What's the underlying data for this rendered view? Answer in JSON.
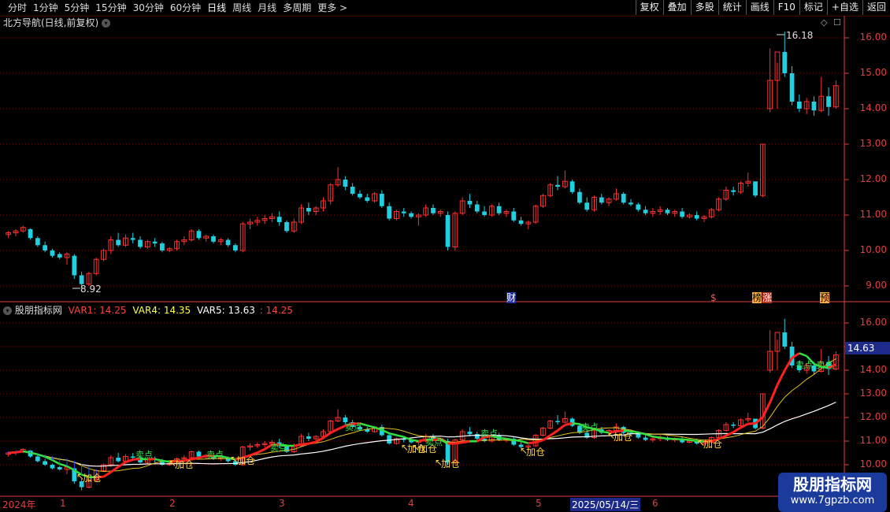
{
  "toolbar": {
    "periods": [
      "分时",
      "1分钟",
      "5分钟",
      "15分钟",
      "30分钟",
      "60分钟",
      "日线",
      "周线",
      "月线",
      "多周期",
      "更多 >"
    ],
    "active": "日线",
    "actions": [
      "复权",
      "叠加",
      "多股",
      "统计",
      "画线",
      "F10",
      "标记",
      "+自选",
      "返回"
    ]
  },
  "main_pane": {
    "title": "北方导航(日线,前复权)",
    "high_label": "16.18",
    "low_label": "8.92",
    "y_ticks": [
      "16.00",
      "15.00",
      "14.00",
      "13.00",
      "12.00",
      "11.00",
      "10.00",
      "9.00"
    ],
    "events": [
      "财",
      "$",
      "榜",
      "涨",
      "预"
    ]
  },
  "indicator_pane": {
    "name": "股朋指标网",
    "var1": "VAR1: 14.25",
    "var4": "VAR4: 14.35",
    "var5": "VAR5: 13.63",
    "extra": ": 14.25",
    "y_ticks": [
      "16.00",
      "15.00",
      "14.00",
      "13.00",
      "12.00",
      "11.00",
      "10.00"
    ],
    "current_price": "14.63",
    "signals": [
      "加仓",
      "加仓",
      "加仓",
      "加仓",
      "加仓",
      "加仓",
      "加仓",
      "加仓",
      "加仓",
      "卖点",
      "卖点",
      "卖点",
      "卖点",
      "卖点",
      "卖点",
      "卖点",
      "卖点",
      "卖点"
    ]
  },
  "date_axis": {
    "labels": [
      "2024年",
      "1",
      "2",
      "3",
      "4",
      "5",
      "2025/05/14/三",
      "6"
    ]
  },
  "watermark": {
    "title": "股朋指标网",
    "url": "www.7gpzb.com"
  },
  "colors": {
    "up": "#ff3030",
    "down": "#20d0e0",
    "axis": "#e04040",
    "grid": "#7a0000"
  },
  "chart_data": {
    "type": "candlestick",
    "ylim": [
      8.7,
      16.5
    ],
    "candles": [
      [
        10.45,
        10.55,
        10.35,
        10.5
      ],
      [
        10.5,
        10.6,
        10.4,
        10.55
      ],
      [
        10.55,
        10.7,
        10.5,
        10.65
      ],
      [
        10.6,
        10.62,
        10.3,
        10.35
      ],
      [
        10.35,
        10.4,
        10.1,
        10.15
      ],
      [
        10.15,
        10.25,
        9.95,
        10.0
      ],
      [
        10.0,
        10.05,
        9.8,
        9.85
      ],
      [
        9.9,
        9.95,
        9.75,
        9.8
      ],
      [
        9.8,
        9.95,
        9.6,
        9.9
      ],
      [
        9.85,
        9.9,
        9.2,
        9.3
      ],
      [
        9.3,
        9.4,
        8.92,
        9.05
      ],
      [
        9.05,
        9.4,
        9.0,
        9.35
      ],
      [
        9.35,
        9.8,
        9.3,
        9.75
      ],
      [
        9.75,
        10.05,
        9.7,
        10.0
      ],
      [
        10.0,
        10.4,
        9.9,
        10.3
      ],
      [
        10.3,
        10.5,
        10.1,
        10.15
      ],
      [
        10.15,
        10.45,
        10.1,
        10.35
      ],
      [
        10.35,
        10.5,
        10.2,
        10.3
      ],
      [
        10.3,
        10.4,
        10.05,
        10.1
      ],
      [
        10.1,
        10.3,
        10.05,
        10.25
      ],
      [
        10.25,
        10.35,
        10.1,
        10.2
      ],
      [
        10.2,
        10.25,
        9.95,
        10.0
      ],
      [
        10.0,
        10.1,
        9.95,
        10.05
      ],
      [
        10.05,
        10.3,
        10.0,
        10.25
      ],
      [
        10.25,
        10.4,
        10.15,
        10.3
      ],
      [
        10.3,
        10.6,
        10.25,
        10.55
      ],
      [
        10.55,
        10.6,
        10.3,
        10.35
      ],
      [
        10.35,
        10.45,
        10.25,
        10.4
      ],
      [
        10.4,
        10.45,
        10.2,
        10.25
      ],
      [
        10.25,
        10.35,
        10.15,
        10.3
      ],
      [
        10.3,
        10.35,
        10.1,
        10.15
      ],
      [
        10.15,
        10.2,
        9.95,
        10.0
      ],
      [
        10.0,
        10.8,
        9.95,
        10.75
      ],
      [
        10.75,
        10.9,
        10.6,
        10.8
      ],
      [
        10.8,
        10.95,
        10.7,
        10.85
      ],
      [
        10.85,
        11.0,
        10.75,
        10.9
      ],
      [
        10.9,
        11.05,
        10.8,
        10.95
      ],
      [
        10.95,
        11.1,
        10.7,
        10.8
      ],
      [
        10.8,
        10.85,
        10.5,
        10.55
      ],
      [
        10.55,
        10.9,
        10.5,
        10.8
      ],
      [
        10.8,
        11.3,
        10.75,
        11.2
      ],
      [
        11.2,
        11.35,
        11.0,
        11.1
      ],
      [
        11.1,
        11.25,
        11.0,
        11.2
      ],
      [
        11.2,
        11.5,
        11.1,
        11.4
      ],
      [
        11.4,
        11.9,
        11.3,
        11.85
      ],
      [
        11.85,
        12.35,
        11.8,
        12.0
      ],
      [
        12.0,
        12.1,
        11.7,
        11.8
      ],
      [
        11.8,
        11.9,
        11.55,
        11.6
      ],
      [
        11.6,
        11.7,
        11.45,
        11.5
      ],
      [
        11.5,
        11.6,
        11.35,
        11.4
      ],
      [
        11.4,
        11.65,
        11.35,
        11.6
      ],
      [
        11.6,
        11.7,
        11.2,
        11.25
      ],
      [
        11.25,
        11.35,
        10.85,
        10.9
      ],
      [
        10.9,
        11.15,
        10.85,
        11.1
      ],
      [
        11.1,
        11.2,
        10.95,
        11.05
      ],
      [
        11.05,
        11.1,
        10.9,
        10.95
      ],
      [
        10.95,
        11.05,
        10.7,
        11.0
      ],
      [
        11.0,
        11.3,
        10.95,
        11.2
      ],
      [
        11.2,
        11.3,
        11.0,
        11.05
      ],
      [
        11.05,
        11.15,
        10.95,
        11.1
      ],
      [
        11.0,
        11.1,
        10.0,
        10.1
      ],
      [
        10.1,
        11.1,
        10.0,
        11.05
      ],
      [
        11.05,
        11.5,
        11.0,
        11.4
      ],
      [
        11.4,
        11.6,
        11.2,
        11.3
      ],
      [
        11.3,
        11.4,
        11.05,
        11.1
      ],
      [
        11.1,
        11.25,
        10.95,
        11.0
      ],
      [
        11.0,
        11.3,
        10.95,
        11.25
      ],
      [
        11.25,
        11.35,
        11.0,
        11.05
      ],
      [
        11.05,
        11.15,
        10.95,
        11.1
      ],
      [
        11.1,
        11.2,
        10.8,
        10.85
      ],
      [
        10.85,
        10.95,
        10.7,
        10.75
      ],
      [
        10.75,
        10.85,
        10.6,
        10.8
      ],
      [
        10.8,
        11.3,
        10.75,
        11.25
      ],
      [
        11.25,
        11.6,
        11.2,
        11.55
      ],
      [
        11.55,
        11.9,
        11.5,
        11.85
      ],
      [
        11.85,
        12.1,
        11.7,
        11.8
      ],
      [
        11.8,
        12.25,
        11.75,
        11.95
      ],
      [
        11.95,
        12.0,
        11.6,
        11.65
      ],
      [
        11.65,
        11.75,
        11.3,
        11.35
      ],
      [
        11.35,
        11.5,
        11.1,
        11.15
      ],
      [
        11.15,
        11.55,
        11.1,
        11.5
      ],
      [
        11.5,
        11.6,
        11.3,
        11.35
      ],
      [
        11.35,
        11.5,
        11.25,
        11.45
      ],
      [
        11.45,
        11.75,
        11.4,
        11.6
      ],
      [
        11.6,
        11.65,
        11.3,
        11.35
      ],
      [
        11.35,
        11.45,
        11.25,
        11.3
      ],
      [
        11.3,
        11.35,
        11.1,
        11.15
      ],
      [
        11.15,
        11.25,
        11.0,
        11.05
      ],
      [
        11.05,
        11.2,
        10.95,
        11.1
      ],
      [
        11.1,
        11.25,
        11.0,
        11.15
      ],
      [
        11.15,
        11.2,
        11.0,
        11.05
      ],
      [
        11.05,
        11.15,
        10.95,
        11.1
      ],
      [
        11.1,
        11.2,
        10.9,
        10.95
      ],
      [
        10.95,
        11.05,
        10.9,
        11.0
      ],
      [
        11.0,
        11.1,
        10.85,
        10.9
      ],
      [
        10.9,
        11.0,
        10.8,
        10.95
      ],
      [
        10.95,
        11.2,
        10.9,
        11.15
      ],
      [
        11.15,
        11.5,
        11.1,
        11.45
      ],
      [
        11.45,
        11.8,
        11.4,
        11.7
      ],
      [
        11.7,
        11.8,
        11.55,
        11.65
      ],
      [
        11.65,
        11.95,
        11.6,
        11.9
      ],
      [
        11.9,
        12.2,
        11.8,
        11.95
      ],
      [
        11.95,
        11.9,
        11.5,
        11.55
      ],
      [
        11.55,
        13.0,
        11.5,
        13.0
      ],
      [
        14.0,
        15.7,
        13.9,
        14.8
      ],
      [
        14.8,
        15.3,
        14.0,
        15.6
      ],
      [
        15.6,
        16.18,
        14.9,
        15.0
      ],
      [
        15.0,
        15.2,
        14.1,
        14.2
      ],
      [
        14.2,
        14.4,
        13.9,
        14.0
      ],
      [
        14.0,
        14.3,
        13.85,
        14.2
      ],
      [
        14.2,
        14.35,
        13.8,
        13.95
      ],
      [
        13.95,
        14.9,
        13.9,
        14.35
      ],
      [
        14.35,
        14.6,
        13.8,
        14.05
      ],
      [
        14.05,
        14.8,
        14.0,
        14.65
      ]
    ]
  }
}
